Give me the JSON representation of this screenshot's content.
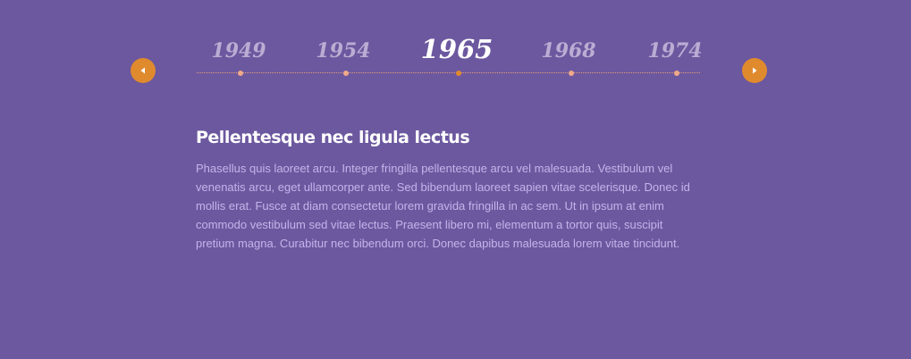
{
  "timeline": {
    "years": [
      "1949",
      "1954",
      "1965",
      "1968",
      "1974"
    ],
    "active_year": "1965"
  },
  "navigation": {
    "prev_icon": "caret-left-icon",
    "next_icon": "caret-right-icon"
  },
  "content": {
    "title": "Pellentesque nec ligula lectus",
    "body": "Phasellus quis laoreet arcu. Integer fringilla pellentesque arcu vel malesuada. Vestibulum vel venenatis arcu, eget ullamcorper ante. Sed bibendum laoreet sapien vitae scelerisque. Donec id mollis erat. Fusce at diam consectetur lorem gravida fringilla in ac sem. Ut in ipsum at enim commodo vestibulum sed vitae lectus. Praesent libero mi, elementum a tortor quis, suscipit pretium magna. Curabitur nec bibendum orci. Donec dapibus malesuada lorem vitae tincidunt."
  },
  "colors": {
    "background": "#6c589f",
    "accent": "#e08a2e",
    "dot": "#f0a98a",
    "inactive_year": "#b9add3",
    "active_year": "#ffffff",
    "body_text": "#c3b4ea"
  }
}
